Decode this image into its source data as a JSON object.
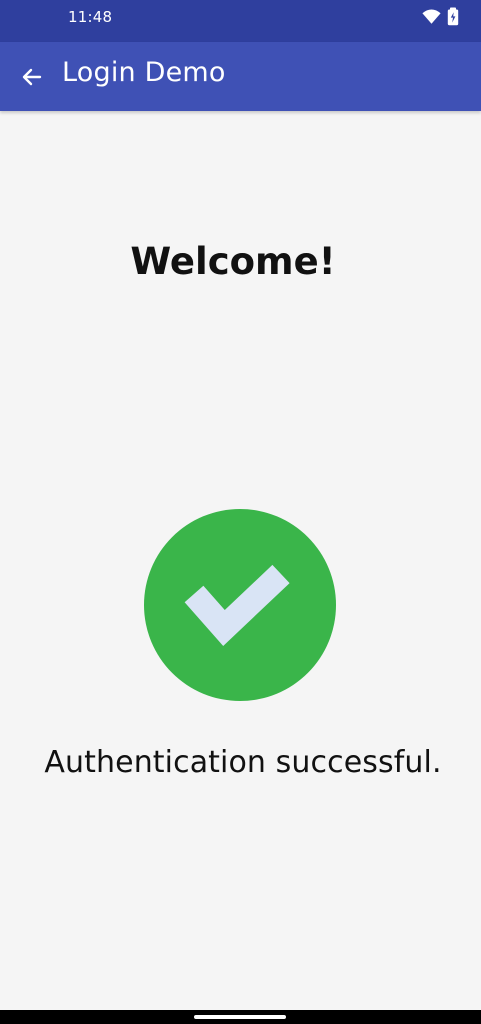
{
  "status_bar": {
    "time": "11:48",
    "icons": [
      "wifi-icon",
      "battery-icon"
    ],
    "color": "#2f3f9e"
  },
  "app_bar": {
    "back_icon": "arrow-left-icon",
    "title": "Login Demo",
    "color": "#3f51b5"
  },
  "content": {
    "heading": "Welcome!",
    "status_icon": "check-circle-icon",
    "status_icon_color": "#3ab54a",
    "check_color": "#d9e4f5",
    "message": "Authentication successful."
  },
  "navigation": {
    "home_indicator": "home-indicator"
  }
}
